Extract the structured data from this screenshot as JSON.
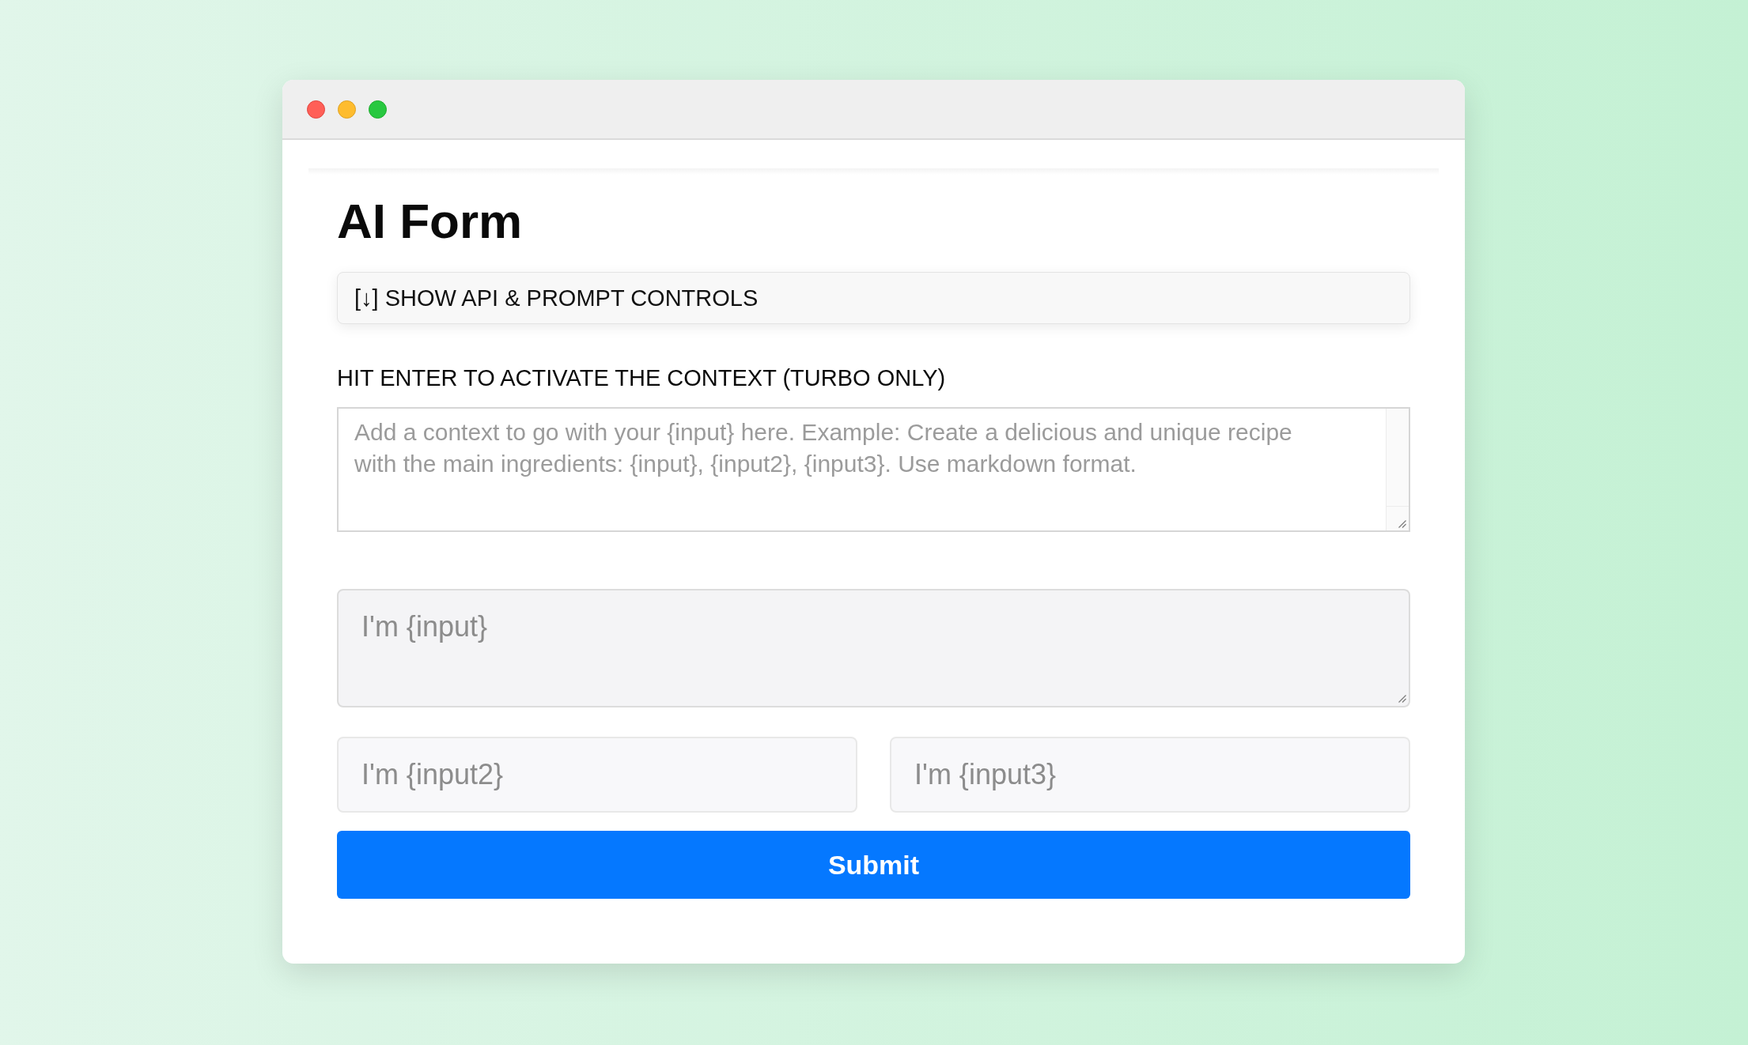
{
  "form": {
    "title": "AI Form",
    "toggle_button": {
      "label": "[↓] SHOW API & PROMPT CONTROLS"
    },
    "context": {
      "label": "HIT ENTER TO ACTIVATE THE CONTEXT (TURBO ONLY)",
      "placeholder": "Add a context to go with your {input} here. Example: Create a delicious and unique recipe with the main ingredients: {input}, {input2}, {input3}. Use markdown format."
    },
    "inputs": [
      {
        "kind": "textarea",
        "placeholder": "I'm {input}"
      },
      {
        "kind": "text",
        "placeholder": "I'm {input2}"
      },
      {
        "kind": "text",
        "placeholder": "I'm {input3}"
      }
    ],
    "submit_button": {
      "label": "Submit"
    }
  }
}
